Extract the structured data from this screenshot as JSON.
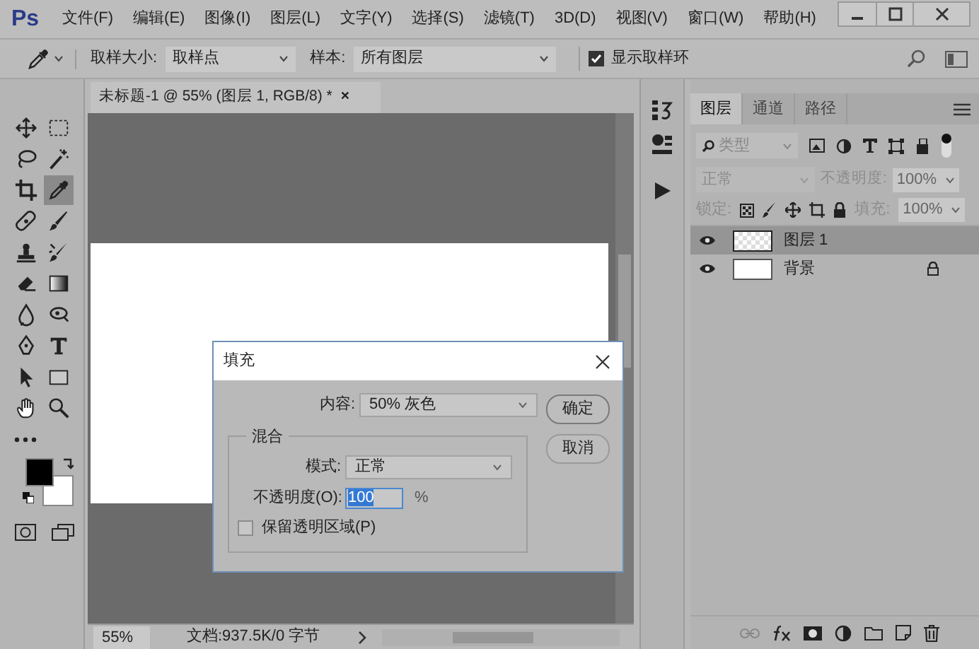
{
  "app_logo": "Ps",
  "menu": [
    "文件(F)",
    "编辑(E)",
    "图像(I)",
    "图层(L)",
    "文字(Y)",
    "选择(S)",
    "滤镜(T)",
    "3D(D)",
    "视图(V)",
    "窗口(W)",
    "帮助(H)"
  ],
  "options_bar": {
    "sample_size_label": "取样大小:",
    "sample_size": "取样点",
    "sample_label": "样本:",
    "sample": "所有图层",
    "show_ring": {
      "label": "显示取样环",
      "checked": true
    }
  },
  "document_tab": {
    "title": "未标题-1 @ 55% (图层 1, RGB/8) *",
    "close": "×"
  },
  "tools": [
    {
      "kind": "move",
      "selected": false
    },
    {
      "kind": "marquee",
      "selected": false
    },
    {
      "kind": "lasso",
      "selected": false
    },
    {
      "kind": "wand",
      "selected": false
    },
    {
      "kind": "crop",
      "selected": false
    },
    {
      "kind": "eyedropper",
      "selected": true
    },
    {
      "kind": "bandage",
      "selected": false
    },
    {
      "kind": "brush",
      "selected": false
    },
    {
      "kind": "stamp",
      "selected": false
    },
    {
      "kind": "history",
      "selected": false
    },
    {
      "kind": "eraser",
      "selected": false
    },
    {
      "kind": "gradient",
      "selected": false
    },
    {
      "kind": "drop",
      "selected": false
    },
    {
      "kind": "dodge",
      "selected": false
    },
    {
      "kind": "pen",
      "selected": false
    },
    {
      "kind": "type",
      "selected": false
    },
    {
      "kind": "pointer",
      "selected": false
    },
    {
      "kind": "rect",
      "selected": false
    },
    {
      "kind": "hand",
      "selected": false
    },
    {
      "kind": "zoom",
      "selected": false
    }
  ],
  "layers_panel": {
    "tabs": [
      {
        "label": "图层",
        "selected": true
      },
      {
        "label": "通道",
        "selected": false
      },
      {
        "label": "路径",
        "selected": false
      }
    ],
    "filter": "类型",
    "blend_mode": "正常",
    "opacity_label": "不透明度:",
    "opacity": "100%",
    "lock_label": "锁定:",
    "fill_label": "填充:",
    "fill": "100%",
    "layers": [
      {
        "name": "图层 1",
        "selected": true,
        "locked": false,
        "transparent": true
      },
      {
        "name": "背景",
        "selected": false,
        "locked": true,
        "transparent": false
      }
    ]
  },
  "status_bar": {
    "zoom": "55%",
    "doc_info": "文档:937.5K/0 字节"
  },
  "dialog": {
    "title": "填充",
    "content_label": "内容:",
    "content": "50% 灰色",
    "group_title": "混合",
    "mode_label": "模式:",
    "mode": "正常",
    "opacity_label": "不透明度(O):",
    "opacity": "100",
    "opacity_unit": "%",
    "preserve": {
      "label": "保留透明区域(P)",
      "checked": false
    },
    "buttons": [
      "确定",
      "取消"
    ]
  }
}
